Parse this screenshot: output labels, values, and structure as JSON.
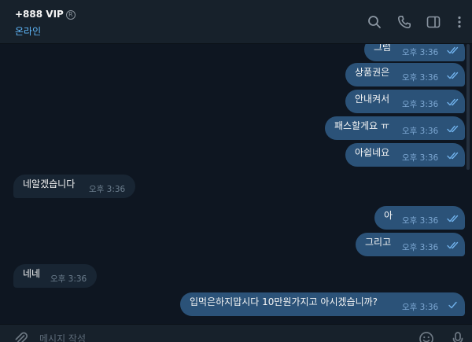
{
  "header": {
    "contact_name": "+888 VIP",
    "registered_mark": "R",
    "status": "온라인",
    "icons": [
      "search-icon",
      "phone-icon",
      "sidebar-toggle-icon",
      "more-vert-icon"
    ]
  },
  "messages": [
    {
      "direction": "out",
      "text": "그럼",
      "time": "오후 3:36",
      "status": "read"
    },
    {
      "direction": "out",
      "text": "상품권은",
      "time": "오후 3:36",
      "status": "read"
    },
    {
      "direction": "out",
      "text": "안내켜서",
      "time": "오후 3:36",
      "status": "read"
    },
    {
      "direction": "out",
      "text": "패스할게요 ㅠ",
      "time": "오후 3:36",
      "status": "read"
    },
    {
      "direction": "out",
      "text": "아쉽네요",
      "time": "오후 3:36",
      "status": "read"
    },
    {
      "direction": "in",
      "text": "네알겠습니다",
      "time": "오후 3:36"
    },
    {
      "direction": "out",
      "text": "아",
      "time": "오후 3:36",
      "status": "read"
    },
    {
      "direction": "out",
      "text": "그리고",
      "time": "오후 3:36",
      "status": "read"
    },
    {
      "direction": "in",
      "text": "네네",
      "time": "오후 3:36"
    },
    {
      "direction": "out",
      "text": "입먹은하지맙시다 10만원가지고 아시겠습니까?",
      "time": "오후 3:36",
      "status": "sent"
    }
  ],
  "composer": {
    "placeholder": "메시지 작성",
    "icons": [
      "attach-icon",
      "emoji-icon",
      "microphone-icon"
    ]
  },
  "colors": {
    "background": "#0e1621",
    "header": "#17212b",
    "outgoing_bubble": "#2b5278",
    "incoming_bubble": "#182533",
    "accent": "#5eb5f7"
  }
}
